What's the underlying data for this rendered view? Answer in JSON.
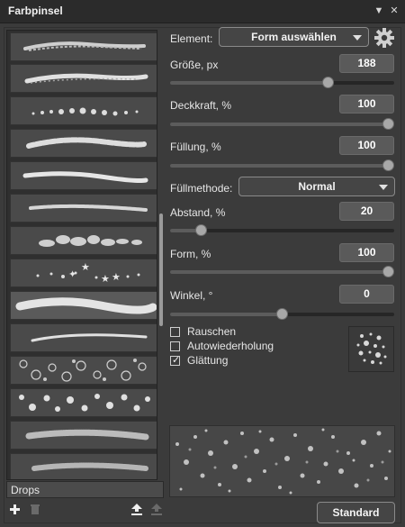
{
  "window": {
    "title": "Farbpinsel",
    "menu_icon": "panel-menu-triangle-icon",
    "close_icon": "close-icon"
  },
  "brush_list": {
    "current_set": "Drops",
    "item_count": 15,
    "selected_index": 8
  },
  "footer_icons": [
    "add-icon",
    "delete-icon",
    "import-icon",
    "export-icon"
  ],
  "element": {
    "label": "Element:",
    "value": "Form auswählen",
    "settings_icon": "gear-icon"
  },
  "controls": {
    "size": {
      "label": "Größe, px",
      "value": "188",
      "level": 0.715
    },
    "opacity": {
      "label": "Deckkraft, %",
      "value": "100",
      "level": 1.0
    },
    "fill": {
      "label": "Füllung, %",
      "value": "100",
      "level": 1.0
    },
    "blend": {
      "label": "Füllmethode:",
      "value": "Normal"
    },
    "spacing": {
      "label": "Abstand, %",
      "value": "20",
      "level": 0.12
    },
    "shape": {
      "label": "Form, %",
      "value": "100",
      "level": 1.0
    },
    "angle": {
      "label": "Winkel, °",
      "value": "0",
      "level": 0.5
    }
  },
  "options": [
    {
      "label": "Rauschen",
      "checked": false
    },
    {
      "label": "Autowiederholung",
      "checked": false
    },
    {
      "label": "Glättung",
      "checked": true
    }
  ],
  "buttons": {
    "default": "Standard"
  },
  "colors": {
    "panel": "#3b3b3b",
    "titlebar": "#2b2b2b",
    "value_box": "#5a5a5a",
    "track": "#262626"
  }
}
